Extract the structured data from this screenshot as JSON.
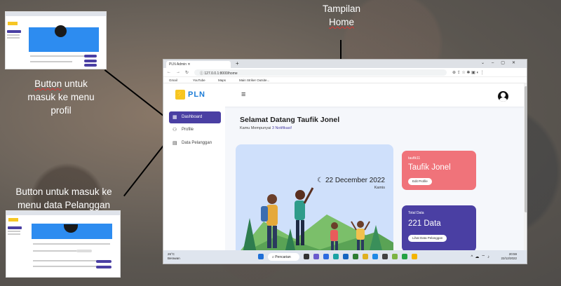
{
  "annotations": {
    "home_label_1": "Tampilan",
    "home_label_2": "Home",
    "profile_label_1_a": "Button",
    "profile_label_1_b": " untuk",
    "profile_label_2": "masuk ke menu",
    "profile_label_3": "profil",
    "customer_label_1": "Button untuk masuk ke",
    "customer_label_2": "menu data Pelanggan"
  },
  "browser": {
    "tab_title": "PLN Admin",
    "url": "127.0.0.1:8000/home",
    "bookmarks": [
      "Gmail",
      "YouTube",
      "Maps",
      "Main Striker Outsite..."
    ]
  },
  "header": {
    "logo_text": "PLN"
  },
  "sidebar": {
    "items": [
      {
        "label": "Dashboard",
        "active": true
      },
      {
        "label": "Profile",
        "active": false
      },
      {
        "label": "Data Pelanggan",
        "active": false
      }
    ]
  },
  "main": {
    "welcome": "Selamat Datang Taufik Jonel",
    "notif_prefix": "Kamu Mempunyai ",
    "notif_count": "3 Notifikasi!",
    "date": "22 December 2022",
    "day": "Kamis"
  },
  "profile_card": {
    "username": "taufik11",
    "name": "Taufik Jonel",
    "button": "Edit Profile"
  },
  "data_card": {
    "label": "Total Data",
    "value": "221 Data",
    "button": "Lihat Data Pelanggan"
  },
  "taskbar": {
    "temp": "26°C",
    "weather": "Berawan",
    "search": "Pencarian",
    "time": "20:59",
    "date": "22/12/2022"
  },
  "colors": {
    "accent": "#4a3fa3",
    "card_red": "#f0737a",
    "hero_bg": "#cfe0fb"
  }
}
